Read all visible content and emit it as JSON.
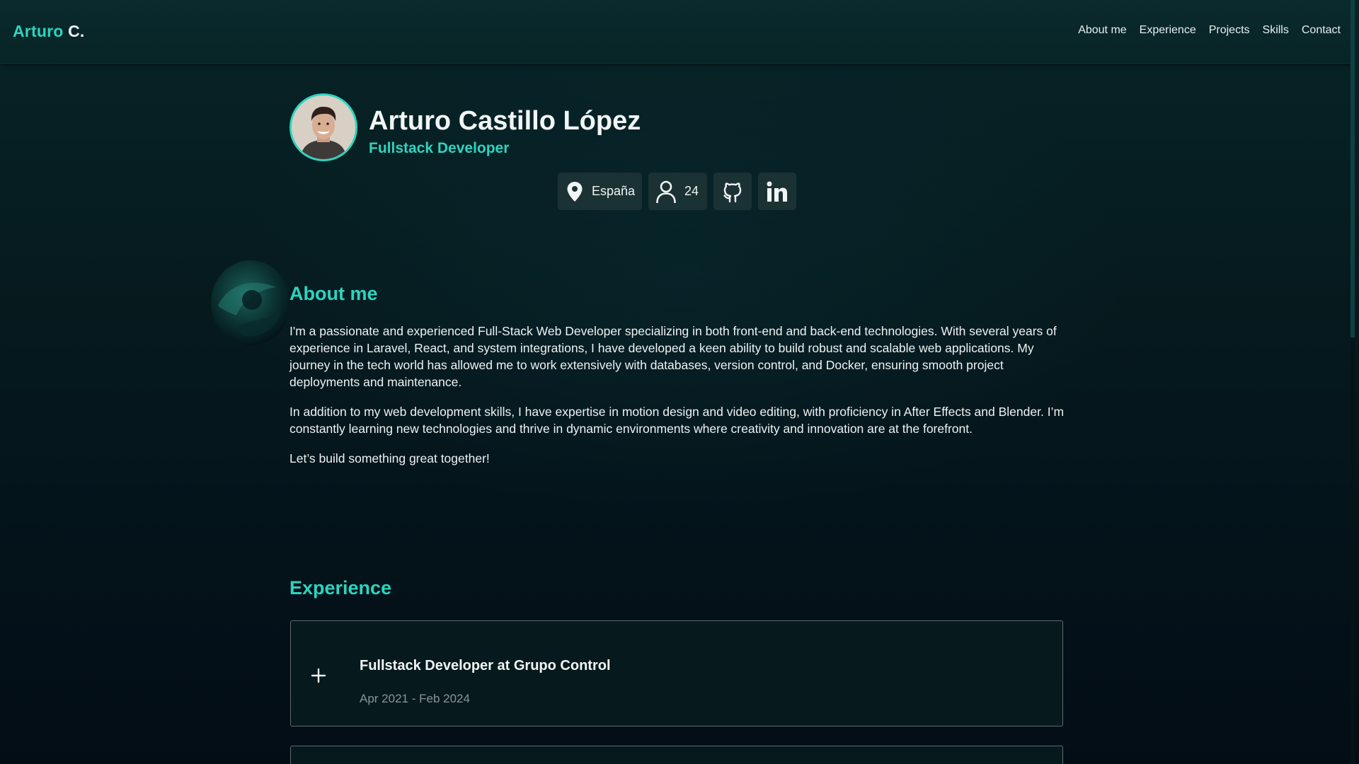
{
  "navbar": {
    "brand_first": "Arturo",
    "brand_last": "C.",
    "links": [
      "About me",
      "Experience",
      "Projects",
      "Skills",
      "Contact"
    ]
  },
  "profile": {
    "name": "Arturo Castillo López",
    "role": "Fullstack Developer",
    "location": "España",
    "age": "24",
    "avatar_icon": "person-photo",
    "location_icon": "map-pin-icon",
    "age_icon": "user-icon",
    "github_icon": "github-icon",
    "linkedin_icon": "linkedin-icon"
  },
  "about": {
    "title": "About me",
    "paragraphs": [
      "I'm a passionate and experienced Full-Stack Web Developer specializing in both front-end and back-end technologies. With several years of experience in Laravel, React, and system integrations, I have developed a keen ability to build robust and scalable web applications. My journey in the tech world has allowed me to work extensively with databases, version control, and Docker, ensuring smooth project deployments and maintenance.",
      "In addition to my web development skills, I have expertise in motion design and video editing, with proficiency in After Effects and Blender. I’m constantly learning new technologies and thrive in dynamic environments where creativity and innovation are at the forefront.",
      "Let’s build something great together!"
    ]
  },
  "experience": {
    "title": "Experience",
    "items": [
      {
        "role": "Fullstack Developer at Grupo Control",
        "dates": "Apr 2021 - Feb 2024"
      }
    ]
  },
  "colors": {
    "accent": "#2dd4bf",
    "background": "#061a1e",
    "chip": "#1b3234",
    "card_border": "#5d6b6e",
    "muted_text": "#8a9596"
  }
}
